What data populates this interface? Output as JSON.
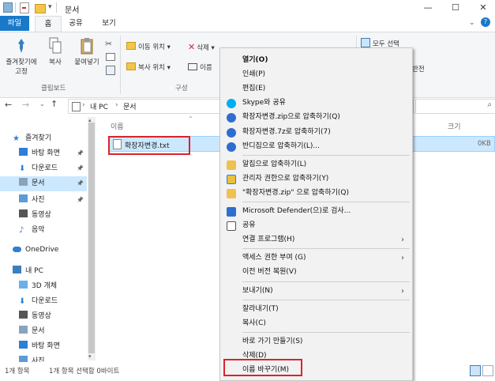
{
  "window": {
    "title": "문서",
    "minimize": "—",
    "maximize": "☐",
    "close": "✕",
    "help": "?"
  },
  "tabs": [
    "파일",
    "홈",
    "공유",
    "보기"
  ],
  "ribbon": {
    "pin_label_1": "즐겨찾기에",
    "pin_label_2": "고정",
    "copy": "복사",
    "paste": "붙여넣기",
    "clipboard_group": "클립보드",
    "move_to": "이동 위치 ▾",
    "copy_to": "복사 위치 ▾",
    "delete": "삭제 ▾",
    "rename": "이름",
    "organize_group": "구성",
    "select_all": "모두 선택",
    "invert": "반전"
  },
  "address": {
    "path_pc": "내 PC",
    "path_sep": "›",
    "path_folder": "문서"
  },
  "nav": [
    {
      "label": "즐겨찾기",
      "icon": "star-icon",
      "pin": false
    },
    {
      "label": "바탕 화면",
      "icon": "desktop-icon",
      "pin": true
    },
    {
      "label": "다운로드",
      "icon": "download-icon",
      "pin": true
    },
    {
      "label": "문서",
      "icon": "document-icon",
      "pin": true,
      "selected": true
    },
    {
      "label": "사진",
      "icon": "picture-icon",
      "pin": true
    },
    {
      "label": "동영상",
      "icon": "video-icon",
      "pin": false
    },
    {
      "label": "음악",
      "icon": "music-icon",
      "pin": false
    },
    {
      "label": "OneDrive",
      "icon": "cloud-icon",
      "pin": false
    },
    {
      "label": "내 PC",
      "icon": "pc-icon",
      "pin": false
    },
    {
      "label": "3D 개체",
      "icon": "cube-icon",
      "pin": false
    },
    {
      "label": "다운로드",
      "icon": "download-icon",
      "pin": false
    },
    {
      "label": "동영상",
      "icon": "video-icon",
      "pin": false
    },
    {
      "label": "문서",
      "icon": "document-icon",
      "pin": false
    },
    {
      "label": "바탕 화면",
      "icon": "desktop-icon",
      "pin": false
    },
    {
      "label": "사진",
      "icon": "picture-icon",
      "pin": false
    }
  ],
  "columns": {
    "name": "이름",
    "size": "크기"
  },
  "file": {
    "name": "확장자변경.txt",
    "size": "0KB"
  },
  "status": {
    "count": "1개 항목",
    "selected": "1개 항목 선택함 0바이트"
  },
  "context_menu": [
    {
      "label": "열기(O)",
      "bold": true
    },
    {
      "label": "인쇄(P)"
    },
    {
      "label": "편집(E)"
    },
    {
      "label": "Skype와 공유",
      "icon": "skype-icon"
    },
    {
      "label": "확장자변경.zip으로 압축하기(Q)",
      "icon": "bandizip-icon"
    },
    {
      "label": "확장자변경.7z로 압축하기(7)",
      "icon": "bandizip-icon"
    },
    {
      "label": "반디집으로 압축하기(L)...",
      "icon": "bandizip-icon"
    },
    {
      "sep": true
    },
    {
      "label": "알집으로 압축하기(L)",
      "icon": "alzip-icon"
    },
    {
      "label": "관리자 권한으로 압축하기(Y)",
      "icon": "shield-icon"
    },
    {
      "label": "\"확장자변경.zip\" 으로 압축하기(Q)",
      "icon": "alzip-icon"
    },
    {
      "sep": true
    },
    {
      "label": "Microsoft Defender(으)로 검사...",
      "icon": "defender-icon"
    },
    {
      "label": "공유",
      "icon": "share-icon"
    },
    {
      "label": "연결 프로그램(H)",
      "arrow": true
    },
    {
      "sep": true
    },
    {
      "label": "액세스 권한 부여 (G)",
      "arrow": true
    },
    {
      "label": "이전 버전 복원(V)"
    },
    {
      "sep": true
    },
    {
      "label": "보내기(N)",
      "arrow": true
    },
    {
      "sep": true
    },
    {
      "label": "잘라내기(T)"
    },
    {
      "label": "복사(C)"
    },
    {
      "sep": true
    },
    {
      "label": "바로 가기 만들기(S)"
    },
    {
      "label": "삭제(D)"
    },
    {
      "label": "이름 바꾸기(M)"
    }
  ],
  "colors": {
    "accent": "#1979ca",
    "selection": "#cce8ff",
    "highlight_box": "#d9232d"
  }
}
